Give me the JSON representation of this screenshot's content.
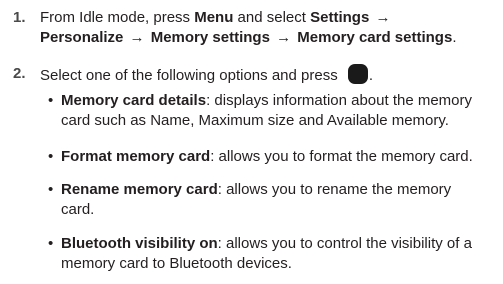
{
  "steps": [
    {
      "number": "1.",
      "line1": {
        "lead": "From Idle mode, press ",
        "menu": "Menu",
        "mid": " and select ",
        "settings": "Settings",
        "arrow": "→"
      },
      "line2": {
        "personalize": "Personalize",
        "arrow1": "→",
        "memory_settings": "Memory settings",
        "arrow2": "→",
        "card_settings": "Memory card settings",
        "end": "."
      }
    },
    {
      "number": "2.",
      "text": "Select one of the following options and press",
      "key_icon": "ok-key-icon",
      "end": "."
    }
  ],
  "options": [
    {
      "title": "Memory card details",
      "line1": ": displays information about the memory",
      "line2": "card such as Name, Maximum size and Available memory."
    },
    {
      "title": "Format memory card",
      "line1": ": allows you to format the memory card."
    },
    {
      "title": "Rename memory card",
      "line1": ": allows you to rename the memory",
      "line2": "card."
    },
    {
      "title": "Bluetooth visibility on",
      "line1": ": allows you to control the visibility of a",
      "line2": "memory card to Bluetooth devices."
    }
  ]
}
